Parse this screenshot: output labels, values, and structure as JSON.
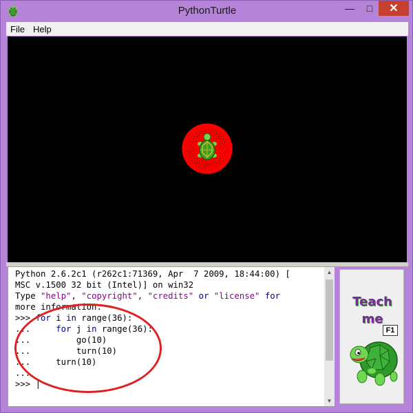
{
  "window": {
    "title": "PythonTurtle",
    "minimize": "—",
    "maximize": "□",
    "close": "✕"
  },
  "menu": [
    {
      "label": "File"
    },
    {
      "label": "Help"
    }
  ],
  "console": {
    "lines": [
      "Python 2.6.2c1 (r262c1:71369, Apr  7 2009, 18:44:00) [",
      "MSC v.1500 32 bit (Intel)] on win32",
      "Type \"help\", \"copyright\", \"credits\" or \"license\" for",
      "more information.",
      ">>> for i in range(36):",
      "...     for j in range(36):",
      "...         go(10)",
      "...         turn(10)",
      "...     turn(10)",
      "...",
      ">>> |"
    ]
  },
  "teach": {
    "line1": "Teach",
    "line2": "me",
    "key": "F1"
  },
  "colors": {
    "pattern": "#ff0000",
    "canvas": "#000000",
    "turtle_shell": "#2e8b1e",
    "annotation": "#e02020"
  },
  "icons": {
    "app": "turtle-icon",
    "turtle": "turtle-sprite",
    "teach": "turtle-mascot-icon"
  },
  "pattern": {
    "loops": 36,
    "steps": 36,
    "step_length": 10,
    "turn_degrees": 10
  }
}
